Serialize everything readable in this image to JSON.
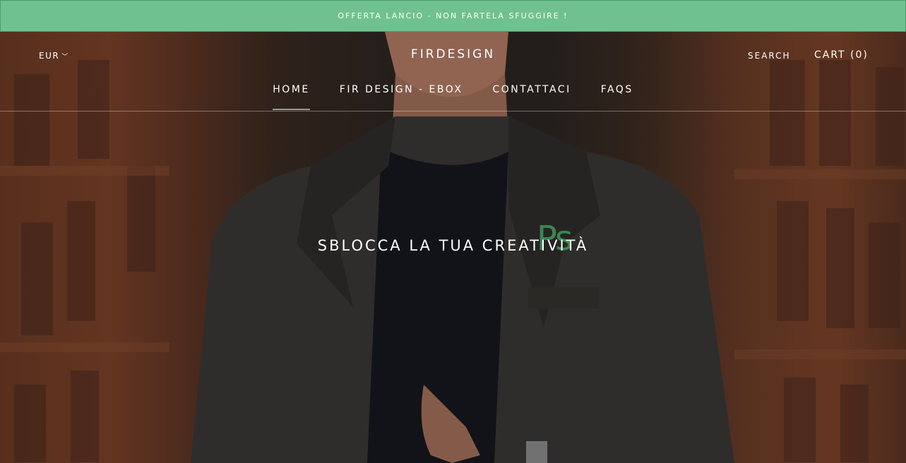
{
  "announcement": {
    "text": "OFFERTA LANCIO - NON FARTELA SFUGGIRE !"
  },
  "header": {
    "currency": "EUR",
    "logo": "FIRDESIGN",
    "search_label": "SEARCH",
    "cart_label": "CART (0)"
  },
  "nav": {
    "items": [
      {
        "label": "HOME",
        "active": true
      },
      {
        "label": "FIR DESIGN - EBOX",
        "active": false
      },
      {
        "label": "CONTATTACI",
        "active": false
      },
      {
        "label": "FAQS",
        "active": false
      }
    ]
  },
  "hero": {
    "title": "SBLOCCA LA TUA CREATIVITÀ",
    "badge": "Ps"
  },
  "colors": {
    "announcement_bg": "#6fc28f",
    "accent_green": "#3fa862",
    "text": "#ffffff"
  }
}
